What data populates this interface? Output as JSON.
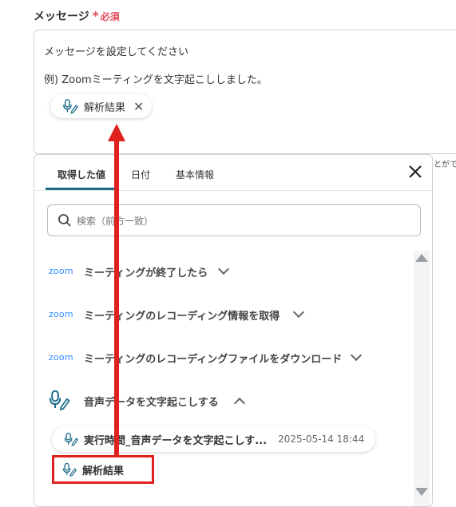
{
  "field": {
    "label": "メッセージ",
    "required_star": "*",
    "required_text": "必須"
  },
  "message": {
    "line1": "メッセージを設定してください",
    "line2": "例) Zoomミーティングを文字起こししました。",
    "chip_label": "解析結果",
    "chip_icon": "microphone-pen-icon",
    "side_text": "とがで"
  },
  "panel": {
    "tabs": [
      {
        "label": "取得した値",
        "active": true
      },
      {
        "label": "日付",
        "active": false
      },
      {
        "label": "基本情報",
        "active": false
      }
    ],
    "search_placeholder": "検索（前方一致）",
    "sections": [
      {
        "logo": "zoom",
        "title": "ミーティングが終了したら",
        "expanded": false
      },
      {
        "logo": "zoom",
        "title": "ミーティングのレコーディング情報を取得",
        "expanded": false
      },
      {
        "logo": "zoom",
        "title": "ミーティングのレコーディングファイルをダウンロード",
        "expanded": false
      },
      {
        "logo": "microphone-pen-icon",
        "title": "音声データを文字起こしする",
        "expanded": true
      }
    ],
    "results": [
      {
        "label": "実行時間_音声データを文字起こしす...",
        "timestamp": "2025-05-14 18:44"
      },
      {
        "label": "解析結果",
        "timestamp": ""
      }
    ]
  },
  "colors": {
    "accent": "#1a6b8a",
    "required": "#e24a57",
    "annotation": "#e0221f",
    "zoom": "#2d8cff"
  }
}
